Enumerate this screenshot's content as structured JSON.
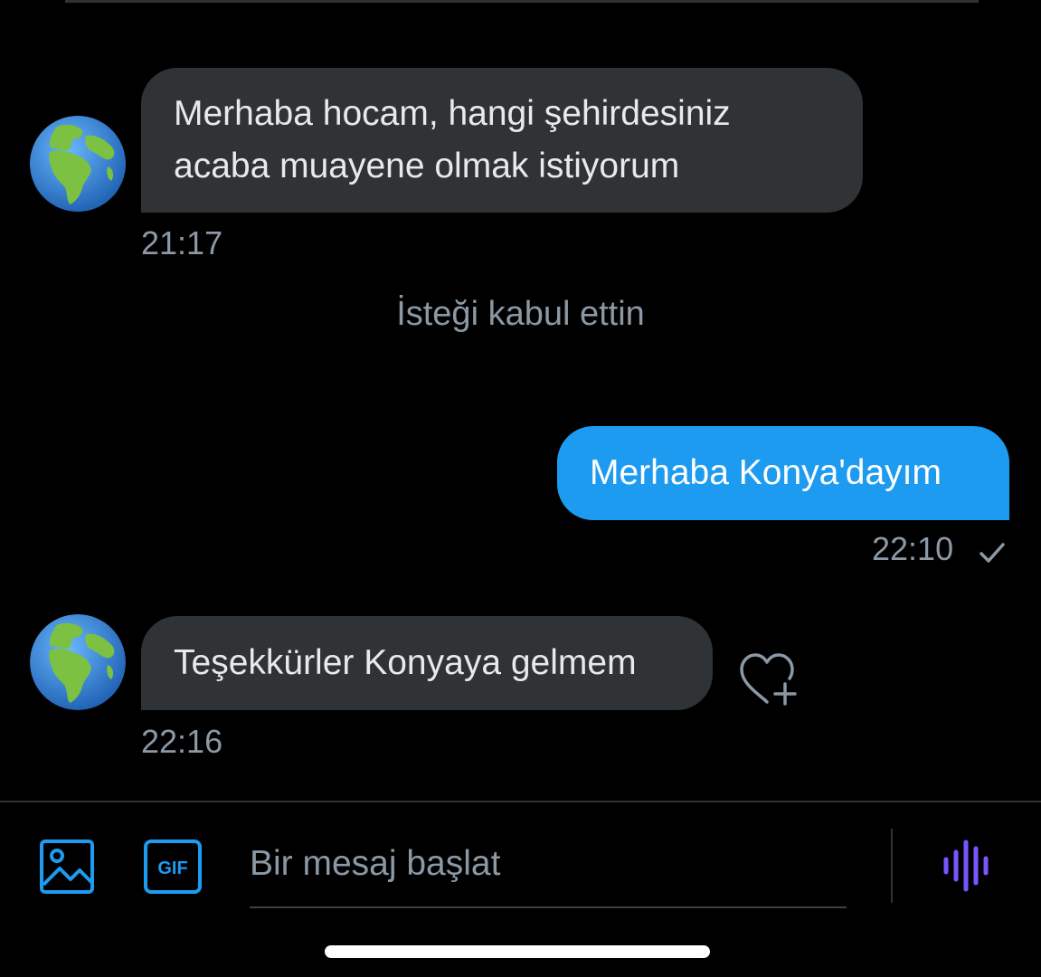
{
  "colors": {
    "background": "#000000",
    "incoming_bubble": "#2f3336",
    "outgoing_bubble": "#1d9bf0",
    "accent": "#1d9bf0",
    "voice_accent": "#7856ff",
    "muted_text": "#8b98a5"
  },
  "messages": {
    "first": {
      "lines": [
        "Merhaba hocam, hangi şehirdesiniz",
        "acaba muayene olmak istiyorum"
      ],
      "time": "21:17"
    },
    "system_note": "İsteği kabul ettin",
    "reply": {
      "text": "Merhaba Konya'dayım",
      "time": "22:10"
    },
    "third": {
      "text": "Teşekkürler Konyaya gelmem",
      "time": "22:16"
    }
  },
  "icons": {
    "avatar": "globe-europe-africa",
    "sent_status": "checkmark",
    "reaction": "heart-plus",
    "media": "image",
    "gif": "gif",
    "voice": "waveform"
  },
  "compose": {
    "placeholder": "Bir mesaj başlat",
    "gif_label": "GIF"
  }
}
